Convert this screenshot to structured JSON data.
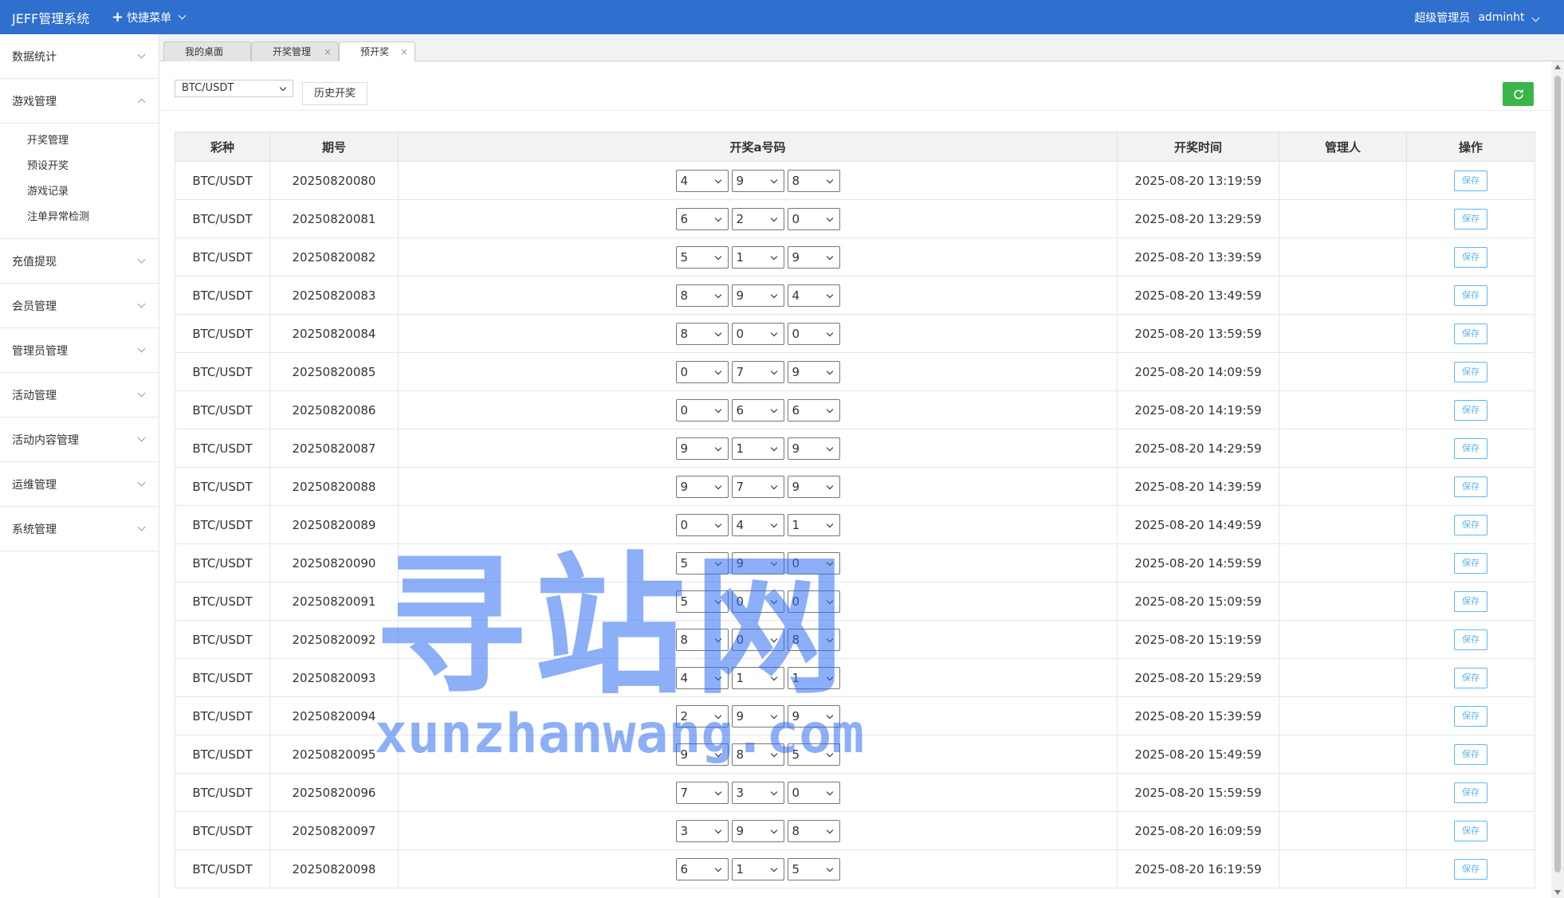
{
  "header": {
    "brand": "JEFF管理系统",
    "quick_menu": "快捷菜单",
    "role": "超级管理员",
    "user": "adminht"
  },
  "sidebar": {
    "items": [
      {
        "label": "数据统计"
      },
      {
        "label": "游戏管理",
        "expanded": true,
        "children": [
          "开奖管理",
          "预设开奖",
          "游戏记录",
          "注单异常检测"
        ]
      },
      {
        "label": "充值提现"
      },
      {
        "label": "会员管理"
      },
      {
        "label": "管理员管理"
      },
      {
        "label": "活动管理"
      },
      {
        "label": "活动内容管理"
      },
      {
        "label": "运维管理"
      },
      {
        "label": "系统管理"
      }
    ]
  },
  "tabs": [
    {
      "label": "我的桌面",
      "closable": false,
      "active": false
    },
    {
      "label": "开奖管理",
      "closable": true,
      "active": false
    },
    {
      "label": "预开奖",
      "closable": true,
      "active": true
    }
  ],
  "toolbar": {
    "lottery_selected": "BTC/USDT",
    "history_button": "历史开奖"
  },
  "table": {
    "headers": [
      "彩种",
      "期号",
      "开奖a号码",
      "开奖时间",
      "管理人",
      "操作"
    ],
    "save_label": "保存",
    "rows": [
      {
        "lottery": "BTC/USDT",
        "issue": "20250820080",
        "nums": [
          "4",
          "9",
          "8"
        ],
        "time": "2025-08-20 13:19:59",
        "admin": ""
      },
      {
        "lottery": "BTC/USDT",
        "issue": "20250820081",
        "nums": [
          "6",
          "2",
          "0"
        ],
        "time": "2025-08-20 13:29:59",
        "admin": ""
      },
      {
        "lottery": "BTC/USDT",
        "issue": "20250820082",
        "nums": [
          "5",
          "1",
          "9"
        ],
        "time": "2025-08-20 13:39:59",
        "admin": ""
      },
      {
        "lottery": "BTC/USDT",
        "issue": "20250820083",
        "nums": [
          "8",
          "9",
          "4"
        ],
        "time": "2025-08-20 13:49:59",
        "admin": ""
      },
      {
        "lottery": "BTC/USDT",
        "issue": "20250820084",
        "nums": [
          "8",
          "0",
          "0"
        ],
        "time": "2025-08-20 13:59:59",
        "admin": ""
      },
      {
        "lottery": "BTC/USDT",
        "issue": "20250820085",
        "nums": [
          "0",
          "7",
          "9"
        ],
        "time": "2025-08-20 14:09:59",
        "admin": ""
      },
      {
        "lottery": "BTC/USDT",
        "issue": "20250820086",
        "nums": [
          "0",
          "6",
          "6"
        ],
        "time": "2025-08-20 14:19:59",
        "admin": ""
      },
      {
        "lottery": "BTC/USDT",
        "issue": "20250820087",
        "nums": [
          "9",
          "1",
          "9"
        ],
        "time": "2025-08-20 14:29:59",
        "admin": ""
      },
      {
        "lottery": "BTC/USDT",
        "issue": "20250820088",
        "nums": [
          "9",
          "7",
          "9"
        ],
        "time": "2025-08-20 14:39:59",
        "admin": ""
      },
      {
        "lottery": "BTC/USDT",
        "issue": "20250820089",
        "nums": [
          "0",
          "4",
          "1"
        ],
        "time": "2025-08-20 14:49:59",
        "admin": ""
      },
      {
        "lottery": "BTC/USDT",
        "issue": "20250820090",
        "nums": [
          "5",
          "9",
          "0"
        ],
        "time": "2025-08-20 14:59:59",
        "admin": ""
      },
      {
        "lottery": "BTC/USDT",
        "issue": "20250820091",
        "nums": [
          "5",
          "0",
          "0"
        ],
        "time": "2025-08-20 15:09:59",
        "admin": ""
      },
      {
        "lottery": "BTC/USDT",
        "issue": "20250820092",
        "nums": [
          "8",
          "0",
          "8"
        ],
        "time": "2025-08-20 15:19:59",
        "admin": ""
      },
      {
        "lottery": "BTC/USDT",
        "issue": "20250820093",
        "nums": [
          "4",
          "1",
          "1"
        ],
        "time": "2025-08-20 15:29:59",
        "admin": ""
      },
      {
        "lottery": "BTC/USDT",
        "issue": "20250820094",
        "nums": [
          "2",
          "9",
          "9"
        ],
        "time": "2025-08-20 15:39:59",
        "admin": ""
      },
      {
        "lottery": "BTC/USDT",
        "issue": "20250820095",
        "nums": [
          "9",
          "8",
          "5"
        ],
        "time": "2025-08-20 15:49:59",
        "admin": ""
      },
      {
        "lottery": "BTC/USDT",
        "issue": "20250820096",
        "nums": [
          "7",
          "3",
          "0"
        ],
        "time": "2025-08-20 15:59:59",
        "admin": ""
      },
      {
        "lottery": "BTC/USDT",
        "issue": "20250820097",
        "nums": [
          "3",
          "9",
          "8"
        ],
        "time": "2025-08-20 16:09:59",
        "admin": ""
      },
      {
        "lottery": "BTC/USDT",
        "issue": "20250820098",
        "nums": [
          "6",
          "1",
          "5"
        ],
        "time": "2025-08-20 16:19:59",
        "admin": ""
      }
    ]
  },
  "watermark": {
    "cn": "寻站网",
    "en": "xunzhanwang.com"
  },
  "colors": {
    "header_bg": "#2f6fce",
    "refresh_btn": "#3ab54a",
    "save_btn": "#5fb6f3"
  }
}
